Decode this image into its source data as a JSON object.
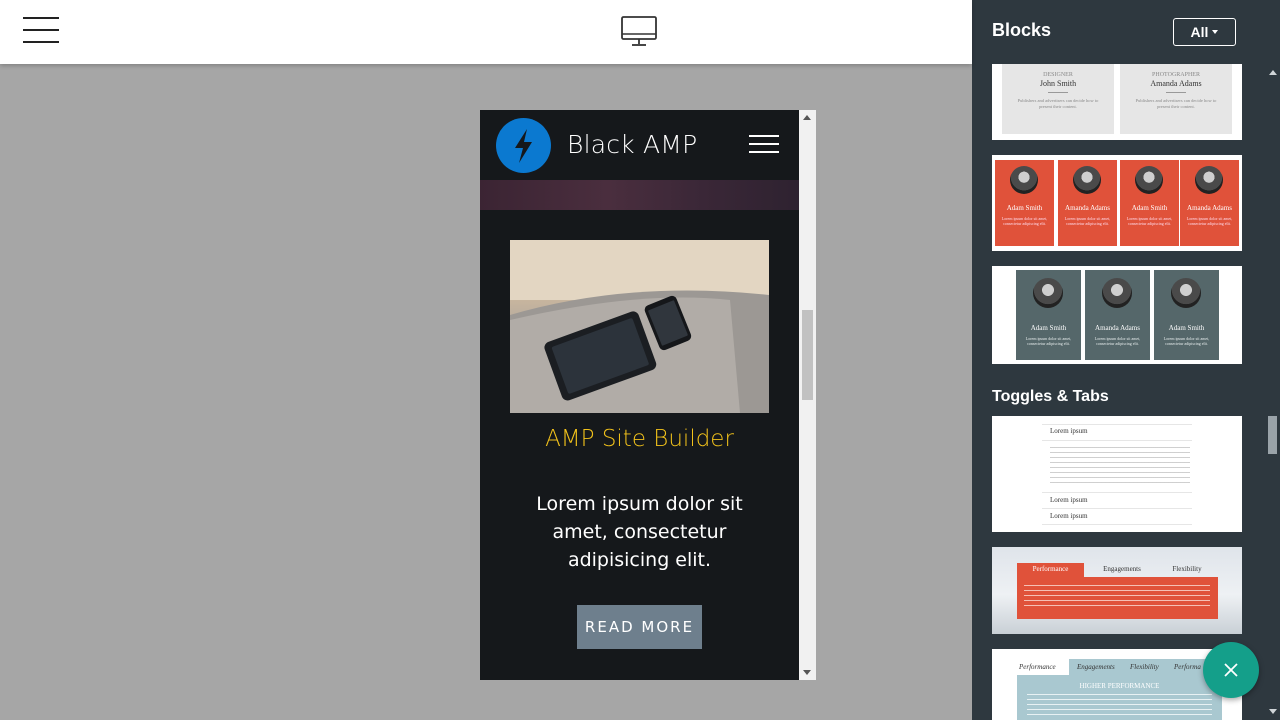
{
  "topbar": {
    "menu_icon": "hamburger-icon",
    "device_icon": "desktop-monitor-icon"
  },
  "preview": {
    "brand": "Black AMP",
    "logo_icon": "lightning-bolt-icon",
    "menu_icon": "hamburger-icon",
    "card_title": "AMP Site Builder",
    "card_text": "Lorem ipsum dolor sit amet, consectetur adipisicing elit.",
    "button_label": "READ MORE",
    "image_icon": "tablet-phone-photo"
  },
  "sidebar": {
    "title": "Blocks",
    "filter_label": "All",
    "team_block_1": {
      "names": [
        "John Smith",
        "Amanda Adams"
      ],
      "roles": [
        "DESIGNER",
        "PHOTOGRAPHER"
      ],
      "text": "Publishers and advertisers can decide how to present their content."
    },
    "team_block_2": {
      "names": [
        "Adam Smith",
        "Amanda Adams",
        "Adam Smith",
        "Amanda Adams"
      ],
      "text": "Lorem ipsum dolor sit amet, consectetur adipiscing elit."
    },
    "team_block_3": {
      "names": [
        "Adam Smith",
        "Amanda Adams",
        "Adam Smith"
      ],
      "text": "Lorem ipsum dolor sit amet, consectetur adipiscing elit."
    },
    "section_toggles": "Toggles & Tabs",
    "toggle_block": {
      "items": [
        "Lorem ipsum",
        "Lorem ipsum",
        "Lorem ipsum"
      ]
    },
    "tabs_block_1": {
      "tabs": [
        "Performance",
        "Engagements",
        "Flexibility"
      ]
    },
    "tabs_block_2": {
      "tabs": [
        "Performance",
        "Engagements",
        "Flexibility",
        "Performa"
      ],
      "heading": "HIGHER PERFORMANCE"
    }
  },
  "fab": {
    "icon": "close-icon"
  },
  "colors": {
    "accent_yellow": "#f2c21b",
    "amp_blue": "#0b79d0",
    "fab_teal": "#149f8a",
    "sidebar_bg": "#2e383f",
    "team_red": "#e0523a",
    "team_slate": "#55676a"
  }
}
